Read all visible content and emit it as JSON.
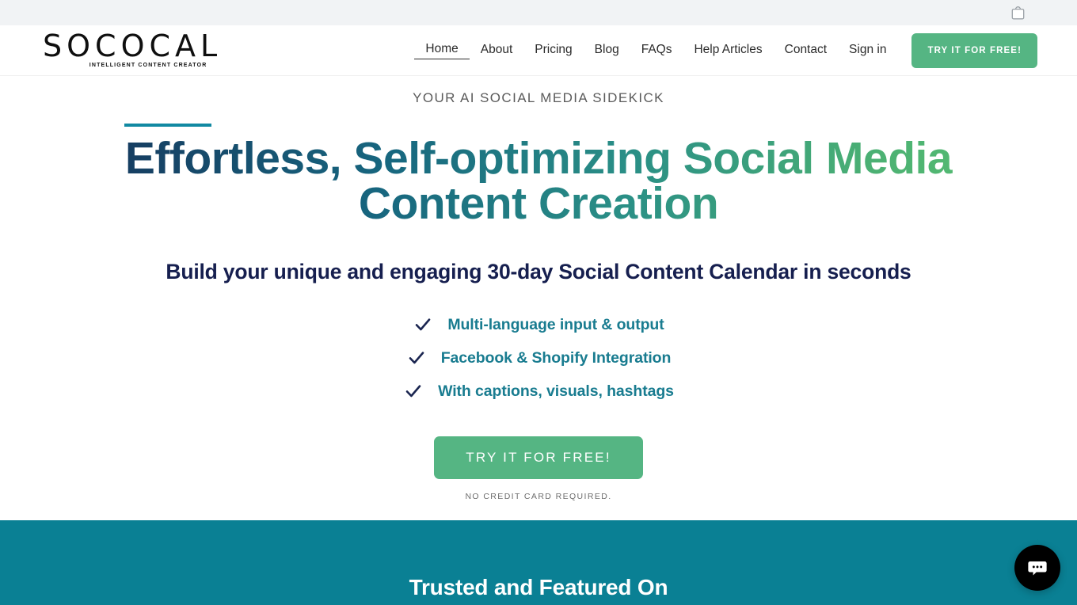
{
  "utility_bar": {
    "cart_icon": "shopping-bag-icon"
  },
  "brand": {
    "word": "SOCOCAL",
    "tagline": "INTELLIGENT CONTENT CREATOR"
  },
  "nav": {
    "items": [
      {
        "label": "Home",
        "active": true
      },
      {
        "label": "About",
        "active": false
      },
      {
        "label": "Pricing",
        "active": false
      },
      {
        "label": "Blog",
        "active": false
      },
      {
        "label": "FAQs",
        "active": false
      },
      {
        "label": "Help Articles",
        "active": false
      },
      {
        "label": "Contact",
        "active": false
      },
      {
        "label": "Sign in",
        "active": false
      }
    ],
    "cta_label": "TRY IT FOR FREE!"
  },
  "hero": {
    "eyebrow": "YOUR AI SOCIAL MEDIA SIDEKICK",
    "title": "Effortless, Self-optimizing Social Media Content Creation",
    "subtitle": "Build your unique and engaging 30-day Social Content Calendar in seconds",
    "features": [
      {
        "icon": "check-icon",
        "text": "Multi-language input & output"
      },
      {
        "icon": "check-icon",
        "text": "Facebook & Shopify Integration"
      },
      {
        "icon": "check-icon",
        "text": "With captions, visuals, hashtags"
      }
    ],
    "cta_label": "TRY IT FOR FREE!",
    "cta_note": "NO CREDIT CARD REQUIRED."
  },
  "trusted": {
    "title": "Trusted and Featured On"
  },
  "chat": {
    "icon": "chat-bubble-icon"
  },
  "colors": {
    "green_cta": "#55b583",
    "teal": "#0a8094",
    "teal_rule": "#1189a2",
    "navy": "#161f4f",
    "feature_teal": "#197c90",
    "utility_bg": "#f1f3f5"
  }
}
